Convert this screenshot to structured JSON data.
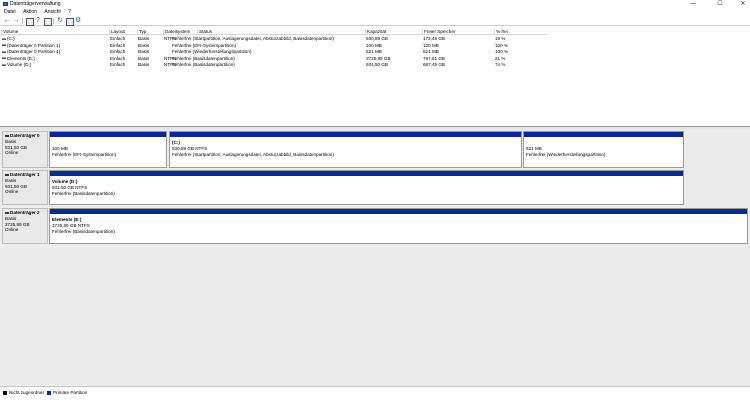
{
  "window": {
    "title": "Datenträgerverwaltung",
    "minimize": "—",
    "maximize": "☐",
    "close": "✕"
  },
  "menu": [
    "Datei",
    "Aktion",
    "Ansicht",
    "?"
  ],
  "columns": [
    "Volume",
    "Layout",
    "Typ",
    "Dateisystem",
    "Status",
    "Kapazität",
    "Freier Speicher",
    "% frei"
  ],
  "volumes": [
    {
      "name": "(C:)",
      "layout": "Einfach",
      "type": "Basis",
      "fs": "NTFS",
      "status": "Fehlerfrei (Startpartition, Auslagerungsdatei, Absturzabbild, Basisdatenpartition)",
      "capacity": "930,89 GB",
      "free": "172,46 GB",
      "pct": "19 %"
    },
    {
      "name": "(Datenträger 0 Partition 1)",
      "layout": "Einfach",
      "type": "Basis",
      "fs": "",
      "status": "Fehlerfrei (EFI-Systempartition)",
      "capacity": "100 MB",
      "free": "100 MB",
      "pct": "100 %"
    },
    {
      "name": "(Datenträger 0 Partition 4)",
      "layout": "Einfach",
      "type": "Basis",
      "fs": "",
      "status": "Fehlerfrei (Wiederherstellungspartition)",
      "capacity": "521 MB",
      "free": "521 MB",
      "pct": "100 %"
    },
    {
      "name": "Elements (E:)",
      "layout": "Einfach",
      "type": "Basis",
      "fs": "NTFS",
      "status": "Fehlerfrei (Basisdatenpartition)",
      "capacity": "3725,99 GB",
      "free": "797,61 GB",
      "pct": "21 %"
    },
    {
      "name": "Volume (D:)",
      "layout": "Einfach",
      "type": "Basis",
      "fs": "NTFS",
      "status": "Fehlerfrei (Basisdatenpartition)",
      "capacity": "931,50 GB",
      "free": "687,49 GB",
      "pct": "74 %"
    }
  ],
  "disks": [
    {
      "name": "Datenträger 0",
      "kind": "Basis",
      "size": "931,50 GB",
      "state": "Online",
      "partitions": [
        {
          "name": "",
          "line1": "100 MB",
          "line2": "Fehlerfrei (EFI-Systempartition)"
        },
        {
          "name": "(C:)",
          "line1": "930,89 GB NTFS",
          "line2": "Fehlerfrei (Startpartition, Auslagerungsdatei, Absturzabbild, Basisdatenpartition)"
        },
        {
          "name": "",
          "line1": "521 MB",
          "line2": "Fehlerfrei (Wiederherstellungspartition)"
        }
      ]
    },
    {
      "name": "Datenträger 1",
      "kind": "Basis",
      "size": "931,50 GB",
      "state": "Online",
      "partitions": [
        {
          "name": "Volume (D:)",
          "line1": "931,50 GB NTFS",
          "line2": "Fehlerfrei (Basisdatenpartition)"
        }
      ]
    },
    {
      "name": "Datenträger 2",
      "kind": "Basis",
      "size": "3725,99 GB",
      "state": "Online",
      "partitions": [
        {
          "name": "Elements (E:)",
          "line1": "3725,99 GB NTFS",
          "line2": "Fehlerfrei (Basisdatenpartition)"
        }
      ]
    }
  ],
  "legend": [
    {
      "label": "Nicht zugeordnet",
      "color": "#000000"
    },
    {
      "label": "Primäre Partition",
      "color": "#0a2a8f"
    }
  ],
  "toolbar_icons": [
    "back-arrow-icon",
    "forward-arrow-icon",
    "disk-list-icon",
    "help-icon",
    "properties-icon",
    "refresh-icon",
    "drive-icon",
    "settings-icon"
  ]
}
